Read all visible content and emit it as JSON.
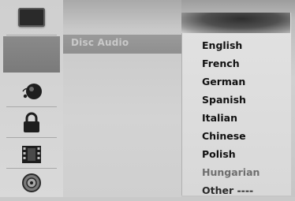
{
  "sidebar": {
    "items": [
      {
        "icon": "disc-tray-icon"
      },
      {
        "icon": "blank-selected"
      },
      {
        "icon": "language-globe-icon"
      },
      {
        "icon": "lock-icon"
      },
      {
        "icon": "film-icon"
      },
      {
        "icon": "disc-icon"
      }
    ]
  },
  "menu": {
    "selected_setting": "Disc Audio"
  },
  "submenu": {
    "options": [
      "English",
      "French",
      "German",
      "Spanish",
      "Italian",
      "Chinese",
      "Polish",
      "Hungarian",
      "Other ----"
    ]
  }
}
